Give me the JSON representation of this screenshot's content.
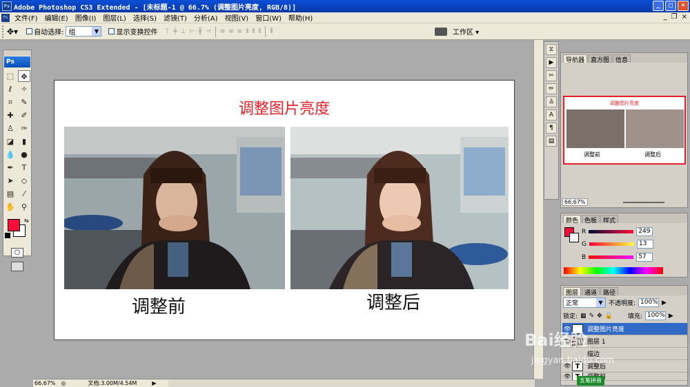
{
  "app": {
    "window_title": "Adobe Photoshop CS3 Extended - [未标题-1 @ 66.7% (调整图片亮度, RGB/8)]",
    "logo_text": "Ps"
  },
  "menu": [
    "文件(F)",
    "编辑(E)",
    "图像(I)",
    "图层(L)",
    "选择(S)",
    "滤镜(T)",
    "分析(A)",
    "视图(V)",
    "窗口(W)",
    "帮助(H)"
  ],
  "options": {
    "auto_select_label": "自动选择:",
    "auto_select_value": "组",
    "show_transform_label": "显示变换控件",
    "workspace_label": "工作区 ▾"
  },
  "document": {
    "title": "调整图片亮度",
    "caption_before": "调整前",
    "caption_after": "调整后"
  },
  "status": {
    "zoom": "66.67%",
    "doc_size": "文档:3.00M/4.54M"
  },
  "navigator": {
    "tabs": [
      "导航器",
      "直方图",
      "信息"
    ],
    "thumb_title": "调整图片亮度",
    "thumb_before": "调整前",
    "thumb_after": "调整后",
    "zoom": "66.67%"
  },
  "color_panel": {
    "tabs": [
      "颜色",
      "色板",
      "样式"
    ],
    "r_label": "R",
    "r_value": "249",
    "g_label": "G",
    "g_value": "13",
    "b_label": "B",
    "b_value": "57",
    "foreground_color": "#f90d39"
  },
  "layers_panel": {
    "tabs": [
      "图层",
      "通道",
      "路径"
    ],
    "blend_mode": "正常",
    "opacity_label": "不透明度:",
    "opacity_value": "100%",
    "lock_label": "锁定:",
    "fill_label": "填充:",
    "fill_value": "100%",
    "layers": [
      {
        "name": "调整图片亮度",
        "type": "T",
        "selected": true
      },
      {
        "name": "图层 1",
        "type": "img",
        "selected": false
      },
      {
        "name": "描边",
        "type": "fx",
        "selected": false
      },
      {
        "name": "调整后",
        "type": "T",
        "selected": false
      },
      {
        "name": "调整前",
        "type": "T",
        "selected": false
      }
    ]
  },
  "ime": {
    "label": "五笔拼音"
  },
  "watermark": {
    "brand": "Bai经验",
    "url": "jingyan.baidu.com"
  }
}
